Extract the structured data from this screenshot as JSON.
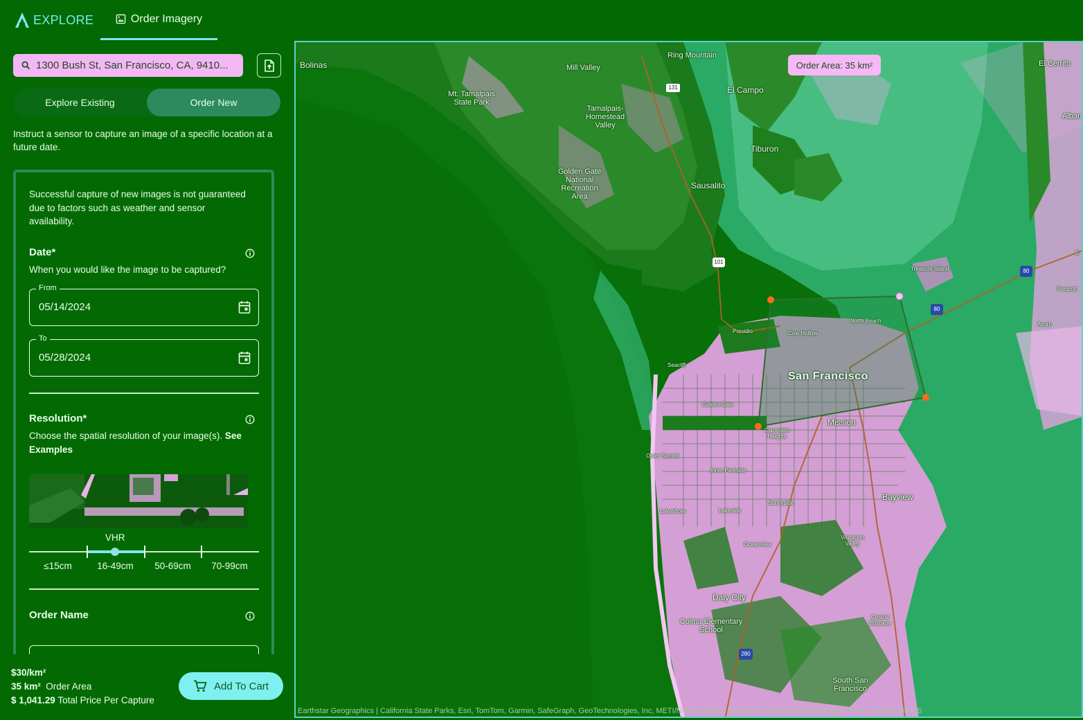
{
  "app": {
    "brand": "EXPLORE",
    "nav_tab": "Order Imagery"
  },
  "search": {
    "value": "1300 Bush St, San Francisco, CA, 9410..."
  },
  "mode": {
    "explore_existing": "Explore Existing",
    "order_new": "Order New",
    "selected": "Order New"
  },
  "intro": "Instruct a sensor to capture an image of a specific location at a future date.",
  "notice": "Successful capture of new images is not guaranteed due to factors such as weather and sensor availability.",
  "date": {
    "title": "Date*",
    "description": "When you would like the image to be captured?",
    "from_label": "From",
    "from_value": "05/14/2024",
    "to_label": "To",
    "to_value": "05/28/2024"
  },
  "resolution": {
    "title": "Resolution*",
    "description": "Choose the spatial resolution of your image(s).",
    "see_examples": "See Examples",
    "selected_tier": "VHR",
    "options": [
      "≤15cm",
      "16-49cm",
      "50-69cm",
      "70-99cm"
    ],
    "selected_index": 1
  },
  "order_name": {
    "title": "Order Name",
    "value": ""
  },
  "footer": {
    "price_per_km": "$30/km²",
    "area_value": "35 km²",
    "area_label": "Order Area",
    "total_value": "$ 1,041.29",
    "total_label": "Total Price Per Capture",
    "add_to_cart": "Add To Cart"
  },
  "map": {
    "order_area_chip": "Order Area: 35 km²",
    "attribution": "Earthstar Geographics | California State Parks, Esri, TomTom, Garmin, SafeGraph, GeoTechnologies, Inc, METI/NASA, USGS, Bureau of Land Management, EPA, NPS, USDA, USFWS",
    "places": {
      "bolinas": "Bolinas",
      "ring_mountain": "Ring Mountain",
      "mill_valley": "Mill Valley",
      "mt_tamalpais": "Mt. Tamalpais State Park",
      "el_campo": "El Campo",
      "tamalpais_homestead": "Tamalpais-Homestead Valley",
      "tiburon": "Tiburon",
      "el_cerrito": "El Cerrito",
      "albany": "Alban",
      "golden_gate_nra": "Golden Gate National Recreation Area",
      "sausalito": "Sausalito",
      "treasure_island": "Treasure Island",
      "prescott": "Prescott",
      "north_beach": "North Beach",
      "cow_hollow": "Cow Hollow",
      "presidio": "Presidio",
      "seacliff": "Seacliff",
      "san_francisco": "San Francisco",
      "golden_gate": "Golden Gate",
      "acorn": "Acorn",
      "mission": "Mission",
      "clarendon_heights": "Clarendon Heights",
      "outer_sunset": "Outer Sunset",
      "inner_parkside": "Inner Parkside",
      "bayview": "Bayview",
      "sunnyside": "Sunnyside",
      "lakeshore": "Lakeshore",
      "lakeside": "Lakeside",
      "visitacion_valley": "Visitacion Valley",
      "oceanview": "Oceanview",
      "daly_city": "Daly City",
      "colma_school": "Colma Elementary School",
      "central_brisbane": "Central Brisbane",
      "south_sf": "South San Francisco",
      "e_label": "E"
    },
    "shields": {
      "us101": "101",
      "ca131": "131",
      "i80a": "80",
      "i80b": "80",
      "i280": "280"
    }
  }
}
